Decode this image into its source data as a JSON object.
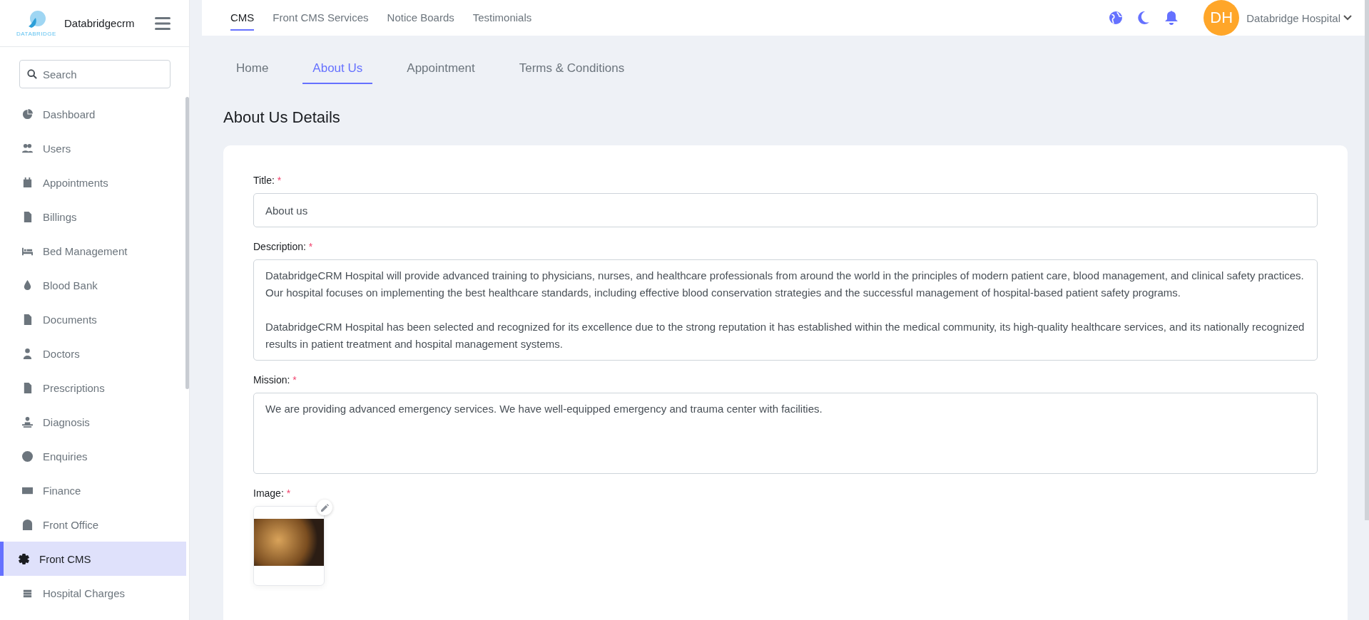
{
  "sidebar": {
    "brand": "Databridgecrm",
    "logo_caption": "DATABRIDGE",
    "search": {
      "placeholder": "Search"
    },
    "items": [
      {
        "label": "Dashboard",
        "selected": false
      },
      {
        "label": "Users",
        "selected": false
      },
      {
        "label": "Appointments",
        "selected": false
      },
      {
        "label": "Billings",
        "selected": false
      },
      {
        "label": "Bed Management",
        "selected": false
      },
      {
        "label": "Blood Bank",
        "selected": false
      },
      {
        "label": "Documents",
        "selected": false
      },
      {
        "label": "Doctors",
        "selected": false
      },
      {
        "label": "Prescriptions",
        "selected": false
      },
      {
        "label": "Diagnosis",
        "selected": false
      },
      {
        "label": "Enquiries",
        "selected": false
      },
      {
        "label": "Finance",
        "selected": false
      },
      {
        "label": "Front Office",
        "selected": false
      },
      {
        "label": "Front CMS",
        "selected": true
      },
      {
        "label": "Hospital Charges",
        "selected": false
      }
    ]
  },
  "top_nav": [
    {
      "label": "CMS",
      "selected": true
    },
    {
      "label": "Front CMS Services",
      "selected": false
    },
    {
      "label": "Notice Boards",
      "selected": false
    },
    {
      "label": "Testimonials",
      "selected": false
    }
  ],
  "user": {
    "initials": "DH",
    "name": "Databridge Hospital"
  },
  "tabs": [
    {
      "label": "Home",
      "selected": false
    },
    {
      "label": "About Us",
      "selected": true
    },
    {
      "label": "Appointment",
      "selected": false
    },
    {
      "label": "Terms & Conditions",
      "selected": false
    }
  ],
  "heading": "About Us Details",
  "fields": [
    {
      "kind": "input",
      "label": "Title:",
      "required_mark": "*",
      "value": "About us"
    },
    {
      "kind": "textarea",
      "label": "Description:",
      "required_mark": "*",
      "value": "DatabridgeCRM Hospital will provide advanced training to physicians, nurses, and healthcare professionals from around the world in the principles of modern patient care, blood management, and clinical safety practices. Our hospital focuses on implementing the best healthcare standards, including effective blood conservation strategies and the successful management of hospital-based patient safety programs.\n\nDatabridgeCRM Hospital has been selected and recognized for its excellence due to the strong reputation it has established within the medical community, its high-quality healthcare services, and its nationally recognized results in patient treatment and hospital management systems."
    },
    {
      "kind": "textarea",
      "label": "Mission:",
      "required_mark": "*",
      "value": "We are providing advanced emergency services. We have well-equipped emergency and trauma center with facilities."
    },
    {
      "kind": "image",
      "label": "Image:",
      "required_mark": "*"
    }
  ]
}
